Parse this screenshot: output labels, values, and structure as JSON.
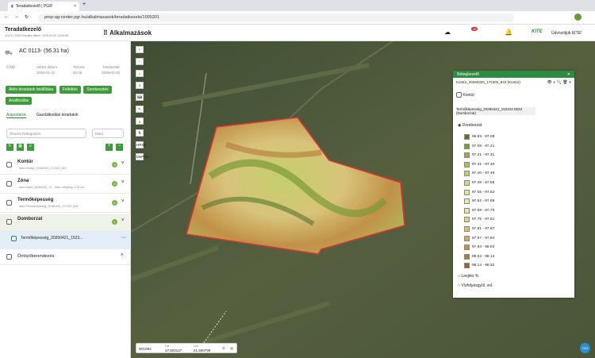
{
  "browser": {
    "tab_title": "Teradatkezelő | PGR",
    "url": "prep-ag-center.pgr.hu/alkalmazasok/teradatkezelo/1005301"
  },
  "app": {
    "logo": "Teradatkezelő",
    "version": "v2.6.2 | 2026 Frissítés dátum: 2026.04.09. 11:00:00",
    "apps_label": "Alkalmazások",
    "greeting": "Üdvözöljük KITE!",
    "notif_count": "15"
  },
  "field": {
    "title": "AC 0113- (56.31 ha)",
    "crop": "Crop",
    "sow_label": "Vetési dátum",
    "sow": "2026-04-10",
    "yield_label": "Termés",
    "yield": "50 ha",
    "sample_label": "Mintavétel",
    "sample": "2026-03-20"
  },
  "buttons": {
    "active": "Aktív téradatok beállítása",
    "upload": "Feltöltés",
    "edit": "Szerkesztés",
    "analyze": "Analitizálás"
  },
  "tabs": {
    "base": "Alapadatok",
    "irr": "Gazdálkodási téradatok"
  },
  "filters": {
    "layer_ph": "Összes Rétegnévre",
    "all_ph": "Mind"
  },
  "groups": [
    {
      "name": "Kontúr",
      "sub": "Aktív Kontúr_20260320_172302_843",
      "count": "3"
    },
    {
      "name": "Zóna",
      "sub": "Aktív Zóna_20260320_17...  Aktív mélység: 0-30 cm",
      "count": "5"
    },
    {
      "name": "Termőképesség",
      "sub": "Aktív Termőképesség_20260320_172302_843",
      "count": "6"
    },
    {
      "name": "Domborzat",
      "sub": "",
      "count": "1"
    }
  ],
  "selected_item": "Termőképesség_20260421_1523...",
  "irrigation": "Öntözőberendezés",
  "layers": {
    "title": "Rétegkezelő",
    "l1": "Kontúr_20260320_172302_843 (Kontúr)",
    "l1sub": "Kontúr",
    "l2": "Termőképesség_20260421_152344 DEM (Domborzat)",
    "l2sub": "Domborzat",
    "extra1": "Leejtés %",
    "extra2": "Vízfolyásgyűl. vol."
  },
  "legend": [
    "96.83 - 97.08",
    "97.08 - 97.21",
    "97.21 - 97.31",
    "97.31 - 97.40",
    "97.40 - 97.48",
    "97.48 - 97.55",
    "97.55 - 97.62",
    "97.62 - 97.69",
    "97.69 - 97.75",
    "97.75 - 97.81",
    "97.81 - 97.87",
    "97.87 - 97.94",
    "97.94 - 98.02",
    "98.02 - 98.14",
    "98.14 - 98.32"
  ],
  "legend_colors": [
    "#55782a",
    "#7a9a38",
    "#94ad45",
    "#aec05a",
    "#c3cf6c",
    "#d3db80",
    "#e2e496",
    "#ede9a6",
    "#efe39a",
    "#e7d386",
    "#dcc06e",
    "#cfa95a",
    "#c19148",
    "#b07a38",
    "#9e622a"
  ],
  "coords": {
    "crs": "WGS84",
    "lat_label": "Lat",
    "lat": "47.503147",
    "lon_label": "Lon",
    "lon": "21.550799"
  },
  "map_controls": [
    "+",
    "−",
    "⌂",
    "≡",
    "⌨",
    "✎",
    "⤓",
    "⇅",
    "HRSZ",
    "MePAR"
  ]
}
